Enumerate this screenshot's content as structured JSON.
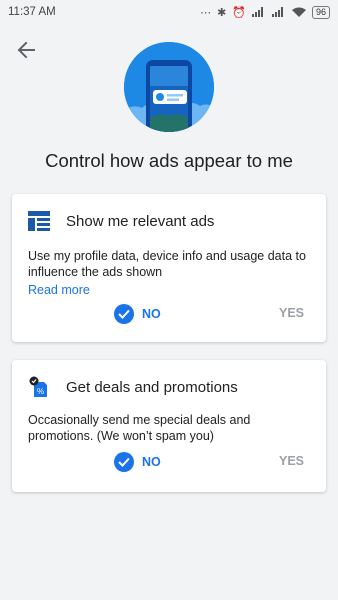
{
  "status_bar": {
    "time": "11:37 AM",
    "battery": "96"
  },
  "page": {
    "title": "Control how ads appear to me"
  },
  "cards": [
    {
      "title": "Show me relevant ads",
      "description": "Use my profile data, device info and usage data to influence the ads shown",
      "link": "Read more",
      "no_label": "NO",
      "yes_label": "YES",
      "selected": "NO"
    },
    {
      "title": "Get deals and promotions",
      "description": "Occasionally send me special deals and promotions. (We won’t spam you)",
      "no_label": "NO",
      "yes_label": "YES",
      "selected": "NO"
    }
  ],
  "colors": {
    "accent": "#1a73e8",
    "hero_bg": "#1e88e5",
    "muted": "#9aa0a6",
    "page_bg": "#f1f3f4"
  },
  "icons": [
    "back-arrow-icon",
    "relevant-ads-icon",
    "deals-tag-icon",
    "check-icon"
  ]
}
